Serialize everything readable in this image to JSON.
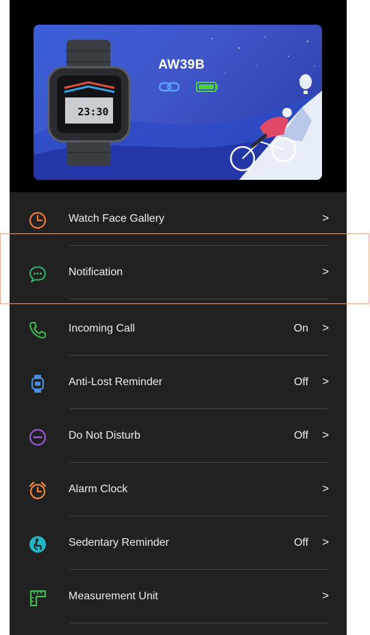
{
  "device": {
    "name": "AW39B",
    "watch_time": "23:30"
  },
  "menu": [
    {
      "label": "Watch Face Gallery",
      "value": "",
      "icon": "watch-face-icon",
      "color": "#ef7b35"
    },
    {
      "label": "Notification",
      "value": "",
      "icon": "message-bubble-icon",
      "color": "#2fb86b"
    },
    {
      "label": "Incoming Call",
      "value": "On",
      "icon": "phone-icon",
      "color": "#3dbf55"
    },
    {
      "label": "Anti-Lost Reminder",
      "value": "Off",
      "icon": "watch-icon",
      "color": "#4a90e2"
    },
    {
      "label": "Do Not Disturb",
      "value": "Off",
      "icon": "minus-circle-icon",
      "color": "#9b59d6"
    },
    {
      "label": "Alarm Clock",
      "value": "",
      "icon": "alarm-clock-icon",
      "color": "#f0843a"
    },
    {
      "label": "Sedentary Reminder",
      "value": "Off",
      "icon": "sedentary-icon",
      "color": "#1fb6c8"
    },
    {
      "label": "Measurement Unit",
      "value": "",
      "icon": "ruler-icon",
      "color": "#3dbf55"
    }
  ],
  "chevron": ">",
  "colors": {
    "background": "#212121",
    "header_background": "#000000",
    "banner_blue": "#3a5fd8",
    "battery_green": "#4cd137",
    "highlight_border": "#e9a88f"
  }
}
